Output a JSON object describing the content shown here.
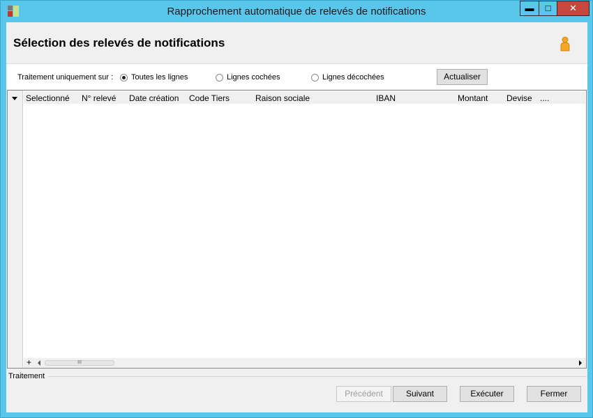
{
  "window": {
    "title": "Rapprochement automatique de relevés de notifications",
    "minimize_glyph": "▬",
    "maximize_glyph": "□",
    "close_glyph": "✕"
  },
  "header": {
    "title": "Sélection des relevés de notifications",
    "user_icon": "user-icon"
  },
  "filter": {
    "label": "Traitement uniquement sur :",
    "options": [
      {
        "label": "Toutes les lignes",
        "checked": true
      },
      {
        "label": "Lignes cochées",
        "checked": false
      },
      {
        "label": "Lignes décochées",
        "checked": false
      }
    ],
    "refresh_label": "Actualiser"
  },
  "grid": {
    "columns": [
      "Selectionné",
      "N° relevé",
      "Date création",
      "Code Tiers",
      "Raison sociale",
      "IBAN",
      "Montant",
      "Devise",
      "...."
    ],
    "rows": [],
    "add_row_glyph": "+",
    "scroll_thumb_glyph": "III"
  },
  "footer": {
    "group_label": "Traitement",
    "previous_label": "Précédent",
    "next_label": "Suivant",
    "execute_label": "Exécuter",
    "close_label": "Fermer"
  },
  "colors": {
    "titlebar": "#59c6ec",
    "close": "#c7463e"
  }
}
